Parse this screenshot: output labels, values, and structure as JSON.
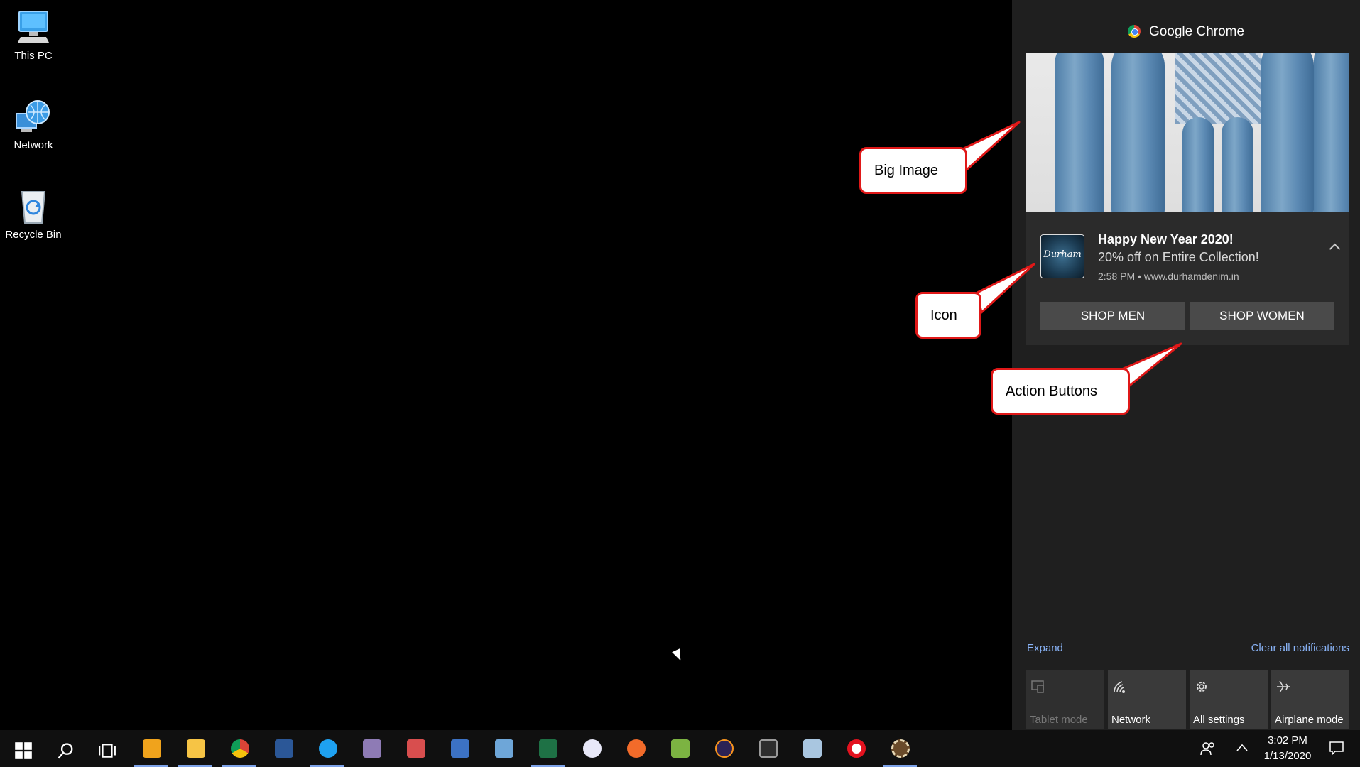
{
  "desktop": {
    "icons": [
      {
        "label": "This PC",
        "icon": "computer-icon"
      },
      {
        "label": "Network",
        "icon": "network-globe-icon"
      },
      {
        "label": "Recycle Bin",
        "icon": "recycle-bin-icon"
      }
    ]
  },
  "action_center": {
    "app_name": "Google Chrome",
    "notification": {
      "title": "Happy New Year 2020!",
      "body": "20% off on Entire Collection!",
      "meta": "2:58 PM • www.durhamdenim.in",
      "icon_text": "Durham",
      "buttons": [
        "SHOP MEN",
        "SHOP WOMEN"
      ]
    },
    "expand_label": "Expand",
    "clear_label": "Clear all notifications",
    "quick_actions": [
      {
        "label": "Tablet mode",
        "icon": "tablet-mode-icon",
        "enabled": false
      },
      {
        "label": "Network",
        "icon": "network-icon",
        "enabled": true
      },
      {
        "label": "All settings",
        "icon": "gear-icon",
        "enabled": true
      },
      {
        "label": "Airplane mode",
        "icon": "airplane-icon",
        "enabled": true
      }
    ]
  },
  "callouts": {
    "big_image": "Big Image",
    "icon": "Icon",
    "action_buttons": "Action Buttons"
  },
  "taskbar": {
    "apps": [
      "start-icon",
      "search-icon",
      "task-view-icon",
      "outlook-icon",
      "file-explorer-icon",
      "chrome-icon",
      "word-icon",
      "internet-explorer-icon",
      "app-icon",
      "paint-icon",
      "remote-desktop-icon",
      "paint-3d-icon",
      "excel-icon",
      "app-icon",
      "sketch-icon",
      "notepad-icon",
      "eclipse-icon",
      "terminal-icon",
      "database-icon",
      "opera-icon",
      "settings-app-icon"
    ],
    "clock_time": "3:02 PM",
    "clock_date": "1/13/2020"
  },
  "colors": {
    "accent": "#7da2e8",
    "callout_border": "#e01818",
    "action_center_bg": "#1f1f1f"
  }
}
